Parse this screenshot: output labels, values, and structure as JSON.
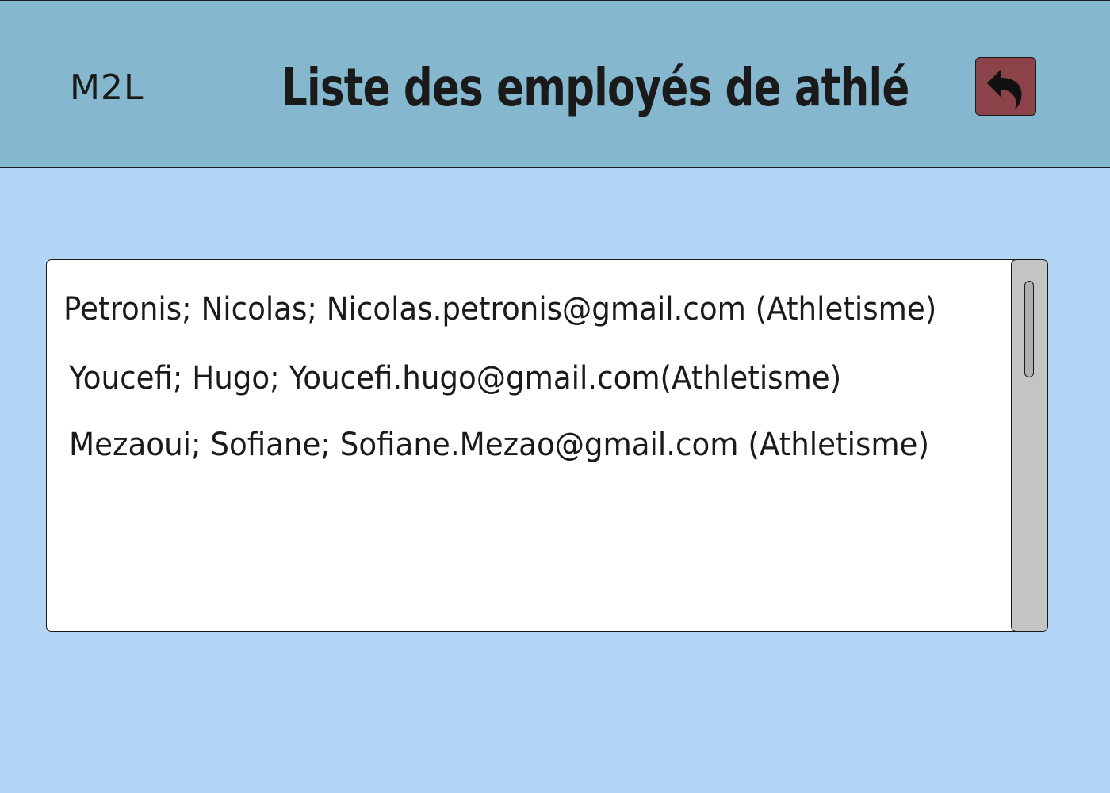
{
  "header": {
    "logo": "M2L",
    "title": "Liste des employés de athlé",
    "back_icon": "back-arrow-icon",
    "back_button_color": "#8c4249",
    "background_color": "#85b7cf"
  },
  "page": {
    "background_color": "#b3d6f6"
  },
  "employees": {
    "items": [
      "Petronis;  Nicolas; Nicolas.petronis@gmail.com (Athletisme)",
      "Youcefi;  Hugo; Youcefi.hugo@gmail.com(Athletisme)",
      "Mezaoui;  Sofiane; Sofiane.Mezao@gmail.com (Athletisme)"
    ]
  }
}
